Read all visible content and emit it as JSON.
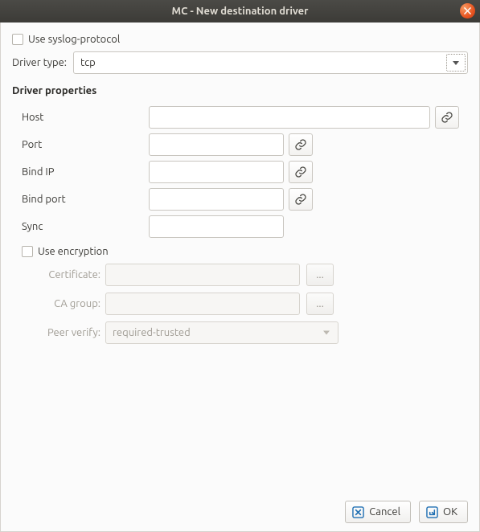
{
  "title": "MC - New destination driver",
  "use_syslog_protocol_label": "Use syslog-protocol",
  "driver_type_label": "Driver type:",
  "driver_type_value": "tcp",
  "section_title": "Driver properties",
  "props": {
    "host": {
      "label": "Host",
      "value": ""
    },
    "port": {
      "label": "Port",
      "value": ""
    },
    "bind_ip": {
      "label": "Bind IP",
      "value": ""
    },
    "bind_port": {
      "label": "Bind port",
      "value": ""
    },
    "sync": {
      "label": "Sync",
      "value": ""
    }
  },
  "use_encryption_label": "Use encryption",
  "enc": {
    "certificate_label": "Certificate:",
    "certificate_value": "",
    "ca_group_label": "CA group:",
    "ca_group_value": "",
    "peer_verify_label": "Peer verify:",
    "peer_verify_value": "required-trusted",
    "browse_label": "..."
  },
  "buttons": {
    "cancel": "Cancel",
    "ok": "OK"
  }
}
